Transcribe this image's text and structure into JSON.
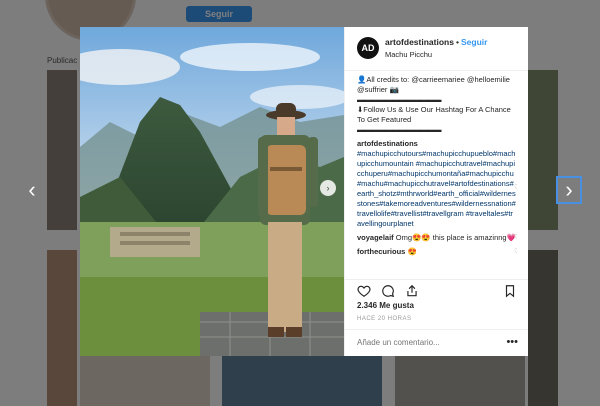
{
  "background": {
    "follow_label": "Seguir",
    "section_label": "Publicac"
  },
  "post": {
    "username": "artofdestinations",
    "separator": "•",
    "follow_label": "Seguir",
    "location": "Machu Picchu",
    "avatar_text": "AD",
    "caption_lines": [
      "👤All credits to: @carrieemariee @helloemilie @suffrier 📷",
      "▬▬▬▬▬▬▬▬▬▬▬▬",
      "⬇Follow Us & Use Our Hashtag For A Chance To Get Featured",
      "▬▬▬▬▬▬▬▬▬▬▬▬"
    ],
    "hashtag_author": "artofdestinations",
    "hashtags": "#machupicchutours#machupicchupueblo#machupicchumountain #machupicchutravel#machupicchuperu#machupicchumontaña#machupicchu #machu#machupicchutravel#artofdestinations#earth_shotz#mthrworld#earth_official#wildernesstones#takemoreadventures#wildernessnation#travellolife#travellist#travellgram #traveltales#travellingourplanet",
    "comments": [
      {
        "user": "voyagelaif",
        "text": "Omg😍😍 this place is amazinng💗"
      },
      {
        "user": "forthecurious",
        "text": "😍"
      }
    ],
    "likes": "2.346 Me gusta",
    "time": "HACE 20 HORAS",
    "add_comment_placeholder": "Añade un comentario...",
    "more": "•••"
  },
  "icons": {
    "heart": "heart-icon",
    "comment": "comment-icon",
    "share": "share-icon",
    "bookmark": "bookmark-icon",
    "prev": "chevron-left-icon",
    "next": "chevron-right-icon"
  },
  "colors": {
    "accent": "#3897f0",
    "overlay": "rgba(0,0,0,0.5)"
  }
}
